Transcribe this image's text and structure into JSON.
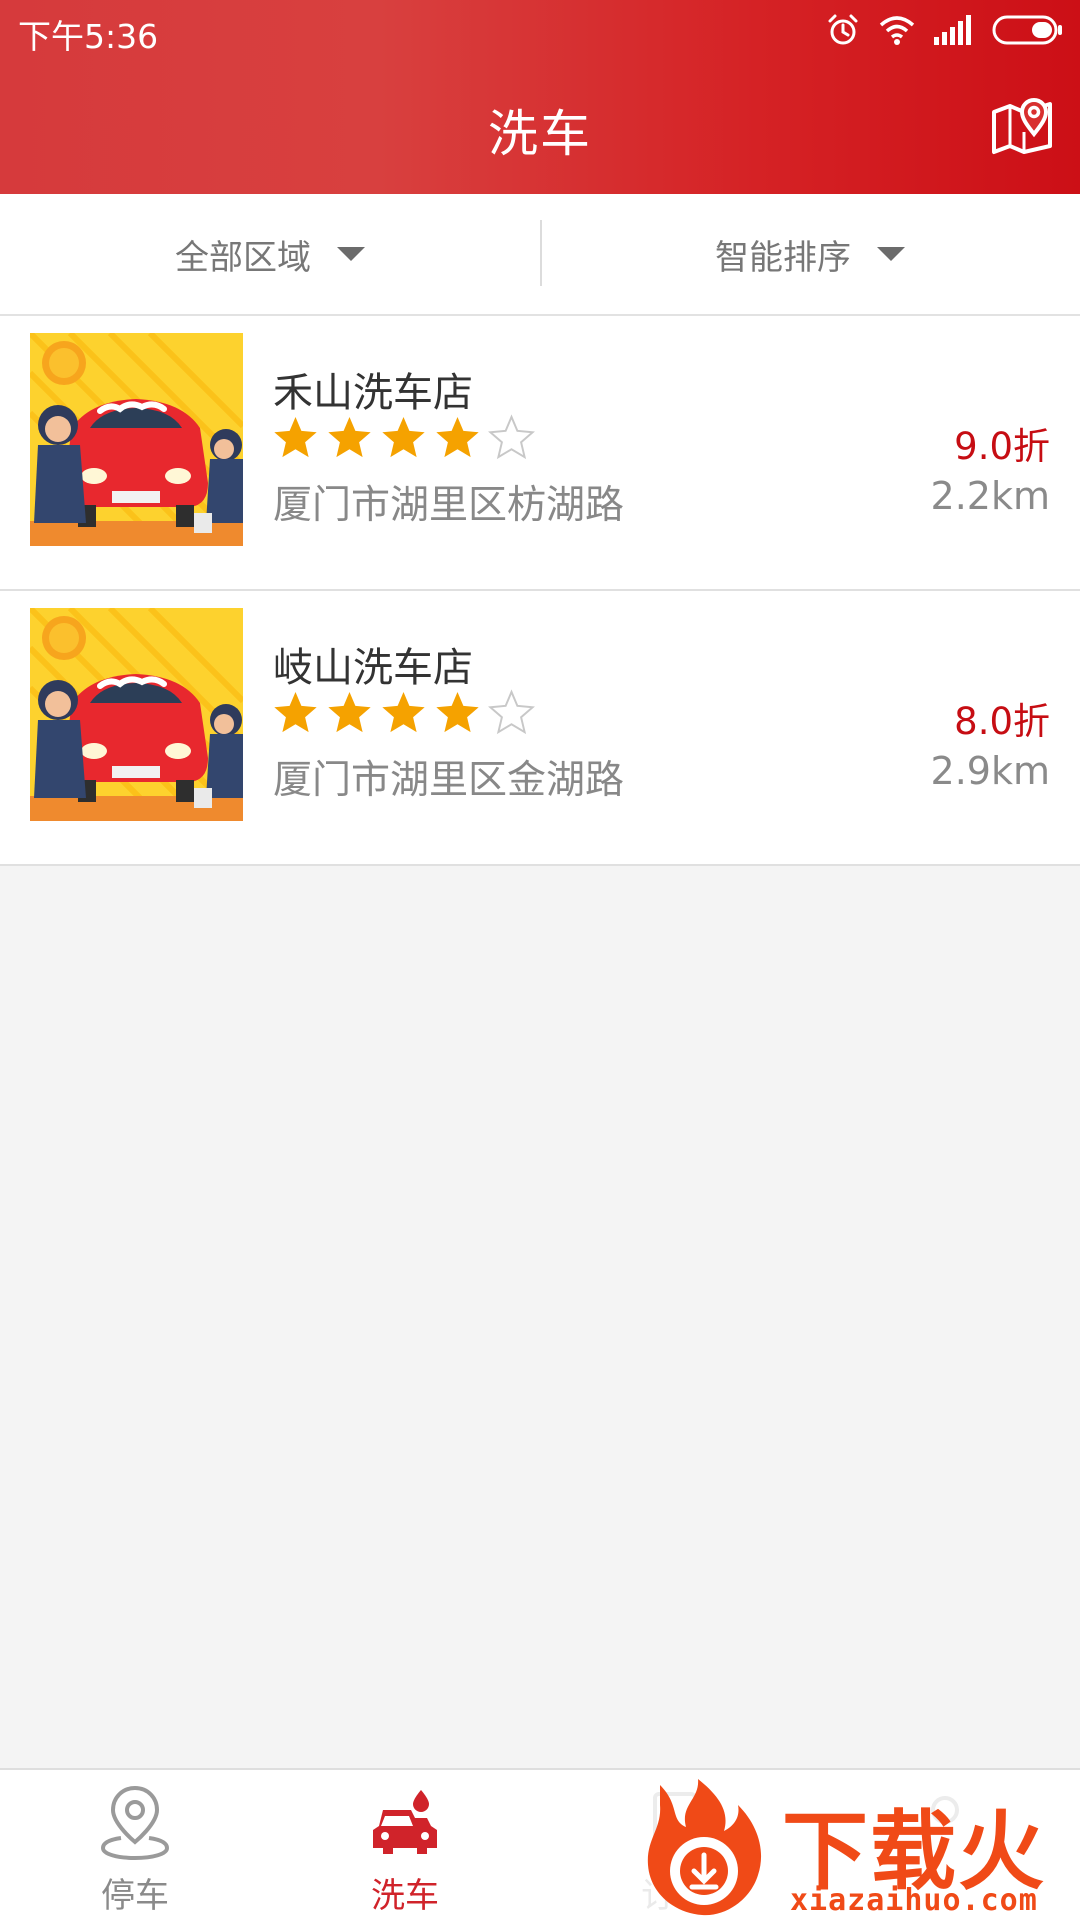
{
  "status_bar": {
    "time": "下午5:36",
    "icons": [
      "alarm-icon",
      "wifi-icon",
      "signal-icon",
      "battery-icon"
    ]
  },
  "header": {
    "title": "洗车",
    "map_icon": "map-pin-icon"
  },
  "filters": [
    {
      "label": "全部区域",
      "icon": "caret-down-icon"
    },
    {
      "label": "智能排序",
      "icon": "caret-down-icon"
    }
  ],
  "shops": [
    {
      "name": "禾山洗车店",
      "rating": 4,
      "rating_max": 5,
      "address": "厦门市湖里区枋湖路",
      "discount": "9.0折",
      "distance": "2.2km"
    },
    {
      "name": "岐山洗车店",
      "rating": 4,
      "rating_max": 5,
      "address": "厦门市湖里区金湖路",
      "discount": "8.0折",
      "distance": "2.9km"
    }
  ],
  "tabs": [
    {
      "label": "停车",
      "icon": "parking-location-icon",
      "active": false
    },
    {
      "label": "洗车",
      "icon": "car-wash-icon",
      "active": true
    },
    {
      "label": "订单",
      "icon": "order-icon",
      "active": false
    }
  ],
  "watermark": {
    "text": "下载火",
    "url": "xiazaihuo.com"
  },
  "colors": {
    "header_start": "#d63a3c",
    "header_end": "#cc0f16",
    "star": "#f5a200",
    "discount": "#c60d13",
    "active_tab": "#d0232a",
    "watermark": "#f04a17"
  }
}
